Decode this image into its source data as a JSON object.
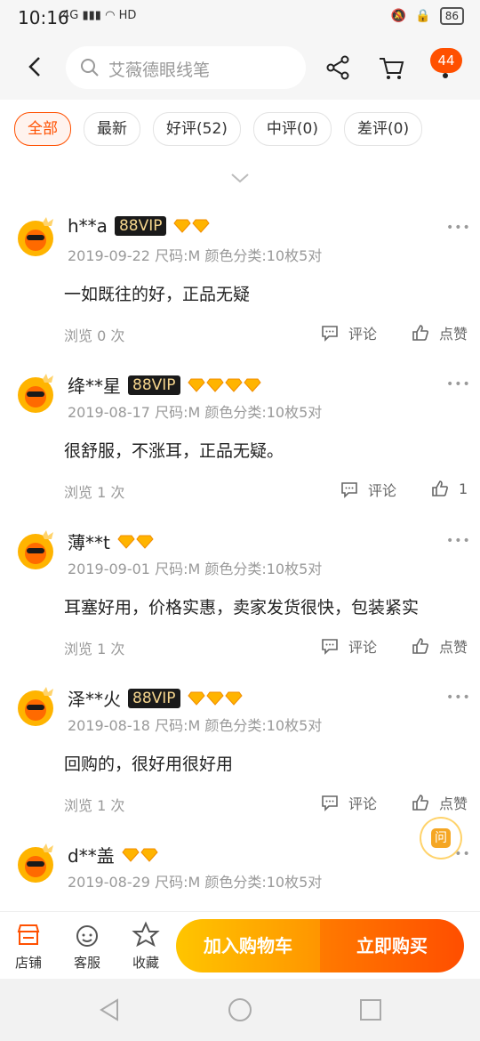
{
  "status": {
    "time": "10:16",
    "net": "4G",
    "hd": "HD",
    "battery": "86"
  },
  "header": {
    "search_placeholder": "艾薇德眼线笔",
    "badge_count": "44"
  },
  "tabs": [
    {
      "label": "全部",
      "active": true
    },
    {
      "label": "最新"
    },
    {
      "label": "好评(52)"
    },
    {
      "label": "中评(0)"
    },
    {
      "label": "差评(0)"
    }
  ],
  "reviews": [
    {
      "user": "h**a",
      "vip": "88VIP",
      "diamonds": 2,
      "meta": "2019-09-22 尺码:M 颜色分类:10枚5对",
      "content": "一如既往的好，正品无疑",
      "views": "浏览 0 次",
      "comment_label": "评论",
      "like_label": "点赞"
    },
    {
      "user": "绛**星",
      "vip": "88VIP",
      "diamonds": 4,
      "meta": "2019-08-17 尺码:M 颜色分类:10枚5对",
      "content": "很舒服，不涨耳，正品无疑。",
      "views": "浏览 1 次",
      "comment_label": "评论",
      "like_label": "1"
    },
    {
      "user": "薄**t",
      "vip": "",
      "diamonds": 2,
      "meta": "2019-09-01 尺码:M 颜色分类:10枚5对",
      "content": "耳塞好用，价格实惠，卖家发货很快，包装紧实",
      "views": "浏览 1 次",
      "comment_label": "评论",
      "like_label": "点赞"
    },
    {
      "user": "泽**火",
      "vip": "88VIP",
      "diamonds": 3,
      "meta": "2019-08-18 尺码:M 颜色分类:10枚5对",
      "content": "回购的，很好用很好用",
      "views": "浏览 1 次",
      "comment_label": "评论",
      "like_label": "点赞"
    },
    {
      "user": "d**盖",
      "vip": "",
      "diamonds": 2,
      "meta": "2019-08-29 尺码:M 颜色分类:10枚5对",
      "content": "",
      "views": "",
      "comment_label": "",
      "like_label": ""
    }
  ],
  "ask_label": "问",
  "bottom": {
    "shop": "店铺",
    "service": "客服",
    "favorite": "收藏",
    "add_cart": "加入购物车",
    "buy_now": "立即购买"
  },
  "colors": {
    "accent": "#ff5000",
    "cart_gradient_start": "#ffc500",
    "buy_gradient_end": "#ff4e00"
  }
}
